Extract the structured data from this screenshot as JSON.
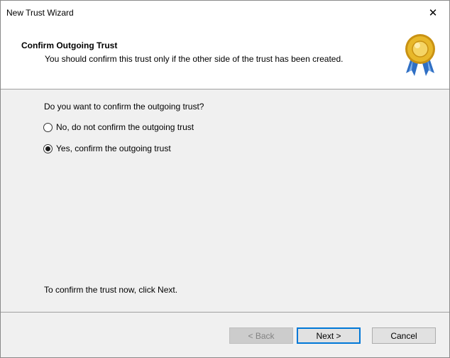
{
  "window": {
    "title": "New Trust Wizard",
    "close_glyph": "✕"
  },
  "header": {
    "title": "Confirm Outgoing Trust",
    "description": "You should confirm this trust only if the other side of the trust has been created.",
    "icon": "award-seal-icon"
  },
  "content": {
    "question": "Do you want to confirm the outgoing trust?",
    "options": [
      {
        "label": "No, do not confirm the outgoing trust",
        "selected": false
      },
      {
        "label": "Yes, confirm the outgoing trust",
        "selected": true
      }
    ],
    "footer": "To confirm the trust now, click Next."
  },
  "buttons": {
    "back": "< Back",
    "next": "Next >",
    "cancel": "Cancel"
  },
  "colors": {
    "accent": "#0078d7",
    "seal_gold": "#e8b82a",
    "ribbon_blue": "#2f6fc4"
  }
}
